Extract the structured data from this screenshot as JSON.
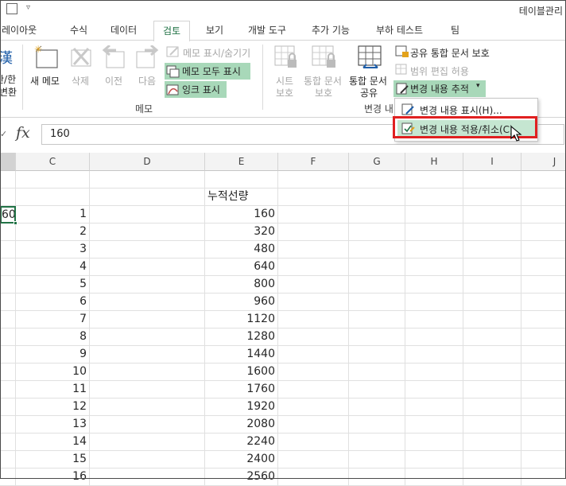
{
  "titlebar": {
    "title": "테이블관리"
  },
  "tabs": [
    {
      "label": "레이아웃",
      "active": false
    },
    {
      "label": "수식",
      "active": false
    },
    {
      "label": "데이터",
      "active": false
    },
    {
      "label": "검토",
      "active": true
    },
    {
      "label": "보기",
      "active": false
    },
    {
      "label": "개발 도구",
      "active": false
    },
    {
      "label": "추가 기능",
      "active": false
    },
    {
      "label": "부하 테스트",
      "active": false
    },
    {
      "label": "팀",
      "active": false
    }
  ],
  "ribbon": {
    "hanja": {
      "line1": "한/한",
      "line2": "변환"
    },
    "memo": {
      "new_label": "새 메모",
      "delete_label": "삭제",
      "prev_label": "이전",
      "next_label": "다음",
      "show_hide": "메모 표시/숨기기",
      "show_all": "메모 모두 표시",
      "ink": "잉크 표시",
      "group_label": "메모"
    },
    "changes": {
      "protect_sheet": {
        "line1": "시트",
        "line2": "보호"
      },
      "protect_workbook": {
        "line1": "통합 문서",
        "line2": "보호"
      },
      "share_workbook": {
        "line1": "통합 문서",
        "line2": "공유"
      },
      "protect_share": "공유 통합 문서 보호",
      "allow_edit_ranges": "범위 편집 허용",
      "track_changes": "변경 내용 추적",
      "group_label": "변경 내"
    }
  },
  "dropdown": {
    "items": [
      {
        "label": "변경 내용 표시(H)..."
      },
      {
        "label": "변경 내용 적용/취소(C)"
      }
    ]
  },
  "formula_bar": {
    "fx": "fx",
    "value": "160"
  },
  "columns": [
    "C",
    "D",
    "E",
    "F",
    "G",
    "H",
    "I",
    "J"
  ],
  "sheet": {
    "header_e": "누적선량",
    "b_visible": "60",
    "rows": [
      {
        "c": "1",
        "e": "160"
      },
      {
        "c": "2",
        "e": "320"
      },
      {
        "c": "3",
        "e": "480"
      },
      {
        "c": "4",
        "e": "640"
      },
      {
        "c": "5",
        "e": "800"
      },
      {
        "c": "6",
        "e": "960"
      },
      {
        "c": "7",
        "e": "1120"
      },
      {
        "c": "8",
        "e": "1280"
      },
      {
        "c": "9",
        "e": "1440"
      },
      {
        "c": "10",
        "e": "1600"
      },
      {
        "c": "11",
        "e": "1760"
      },
      {
        "c": "12",
        "e": "1920"
      },
      {
        "c": "13",
        "e": "2080"
      },
      {
        "c": "14",
        "e": "2240"
      },
      {
        "c": "15",
        "e": "2400"
      },
      {
        "c": "16",
        "e": "2560"
      }
    ]
  },
  "colors": {
    "accent": "#217346",
    "highlight": "#a8d8b9",
    "selected_item": "#c5e6d1",
    "callout": "#e02020"
  }
}
